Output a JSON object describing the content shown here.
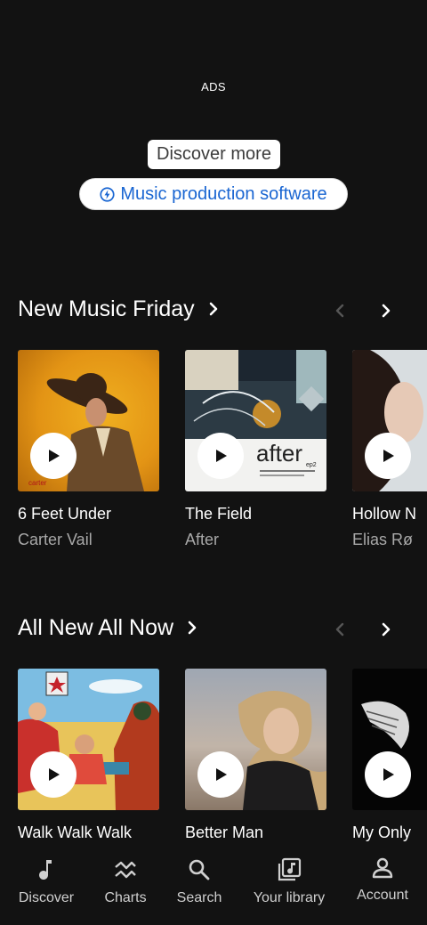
{
  "ad": {
    "label": "ADS",
    "discover_more": "Discover more",
    "link_text": "Music production software"
  },
  "sections": [
    {
      "title": "New Music Friday",
      "cards": [
        {
          "title": "6 Feet Under",
          "artist": "Carter Vail"
        },
        {
          "title": "The Field",
          "artist": "After"
        },
        {
          "title": "Hollow N",
          "artist": "Elias Rø"
        }
      ]
    },
    {
      "title": "All New All Now",
      "cards": [
        {
          "title": "Walk Walk Walk",
          "artist": ""
        },
        {
          "title": "Better Man",
          "artist": ""
        },
        {
          "title": "My Only",
          "artist": ""
        }
      ]
    }
  ],
  "bottom_nav": [
    {
      "label": "Discover",
      "icon": "music-note-icon"
    },
    {
      "label": "Charts",
      "icon": "charts-icon"
    },
    {
      "label": "Search",
      "icon": "search-icon"
    },
    {
      "label": "Your library",
      "icon": "library-icon"
    },
    {
      "label": "Account",
      "icon": "account-icon"
    }
  ],
  "colors": {
    "background": "#121212",
    "ad_link": "#1a66d2",
    "secondary_text": "#a8a8a8"
  }
}
